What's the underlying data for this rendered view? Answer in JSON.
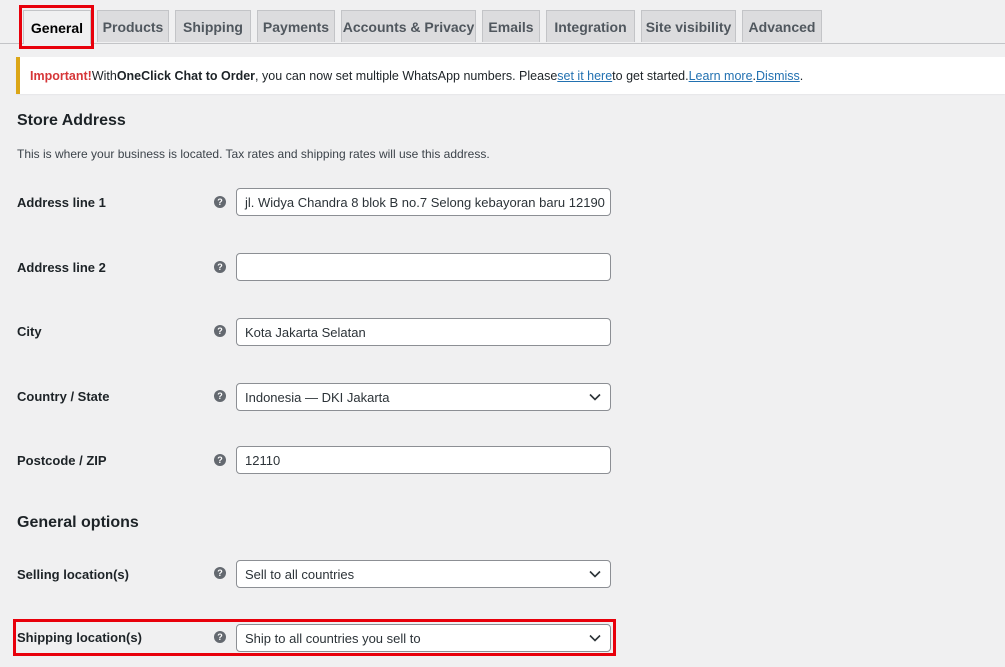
{
  "tabs": [
    {
      "label": "General",
      "active": true
    },
    {
      "label": "Products"
    },
    {
      "label": "Shipping"
    },
    {
      "label": "Payments"
    },
    {
      "label": "Accounts & Privacy"
    },
    {
      "label": "Emails"
    },
    {
      "label": "Integration"
    },
    {
      "label": "Site visibility"
    },
    {
      "label": "Advanced"
    }
  ],
  "notice": {
    "important": "Important!",
    "text1": " With ",
    "plugin": "OneClick Chat to Order",
    "text2": ", you can now set multiple WhatsApp numbers. Please ",
    "link_set": "set it here",
    "text3": " to get started. ",
    "link_learn": "Learn more",
    "sep": ". ",
    "link_dismiss": "Dismiss",
    "end": "."
  },
  "store_address": {
    "title": "Store Address",
    "description": "This is where your business is located. Tax rates and shipping rates will use this address.",
    "fields": [
      {
        "label": "Address line 1",
        "value": "jl. Widya Chandra 8 blok B no.7 Selong kebayoran baru 12190"
      },
      {
        "label": "Address line 2",
        "value": ""
      },
      {
        "label": "City",
        "value": "Kota Jakarta Selatan"
      },
      {
        "label": "Country / State",
        "value": "Indonesia — DKI Jakarta"
      },
      {
        "label": "Postcode / ZIP",
        "value": "12110"
      }
    ]
  },
  "general_options": {
    "title": "General options",
    "fields": [
      {
        "label": "Selling location(s)",
        "value": "Sell to all countries"
      },
      {
        "label": "Shipping location(s)",
        "value": "Ship to all countries you sell to"
      }
    ]
  },
  "help_icon": "?",
  "icons": {
    "help": "help-circle-icon",
    "dropdown": "chevron-down-icon"
  },
  "colors": {
    "highlight": "#e8000b",
    "notice_border": "#dba617",
    "link": "#2271b1",
    "important": "#d63638"
  }
}
